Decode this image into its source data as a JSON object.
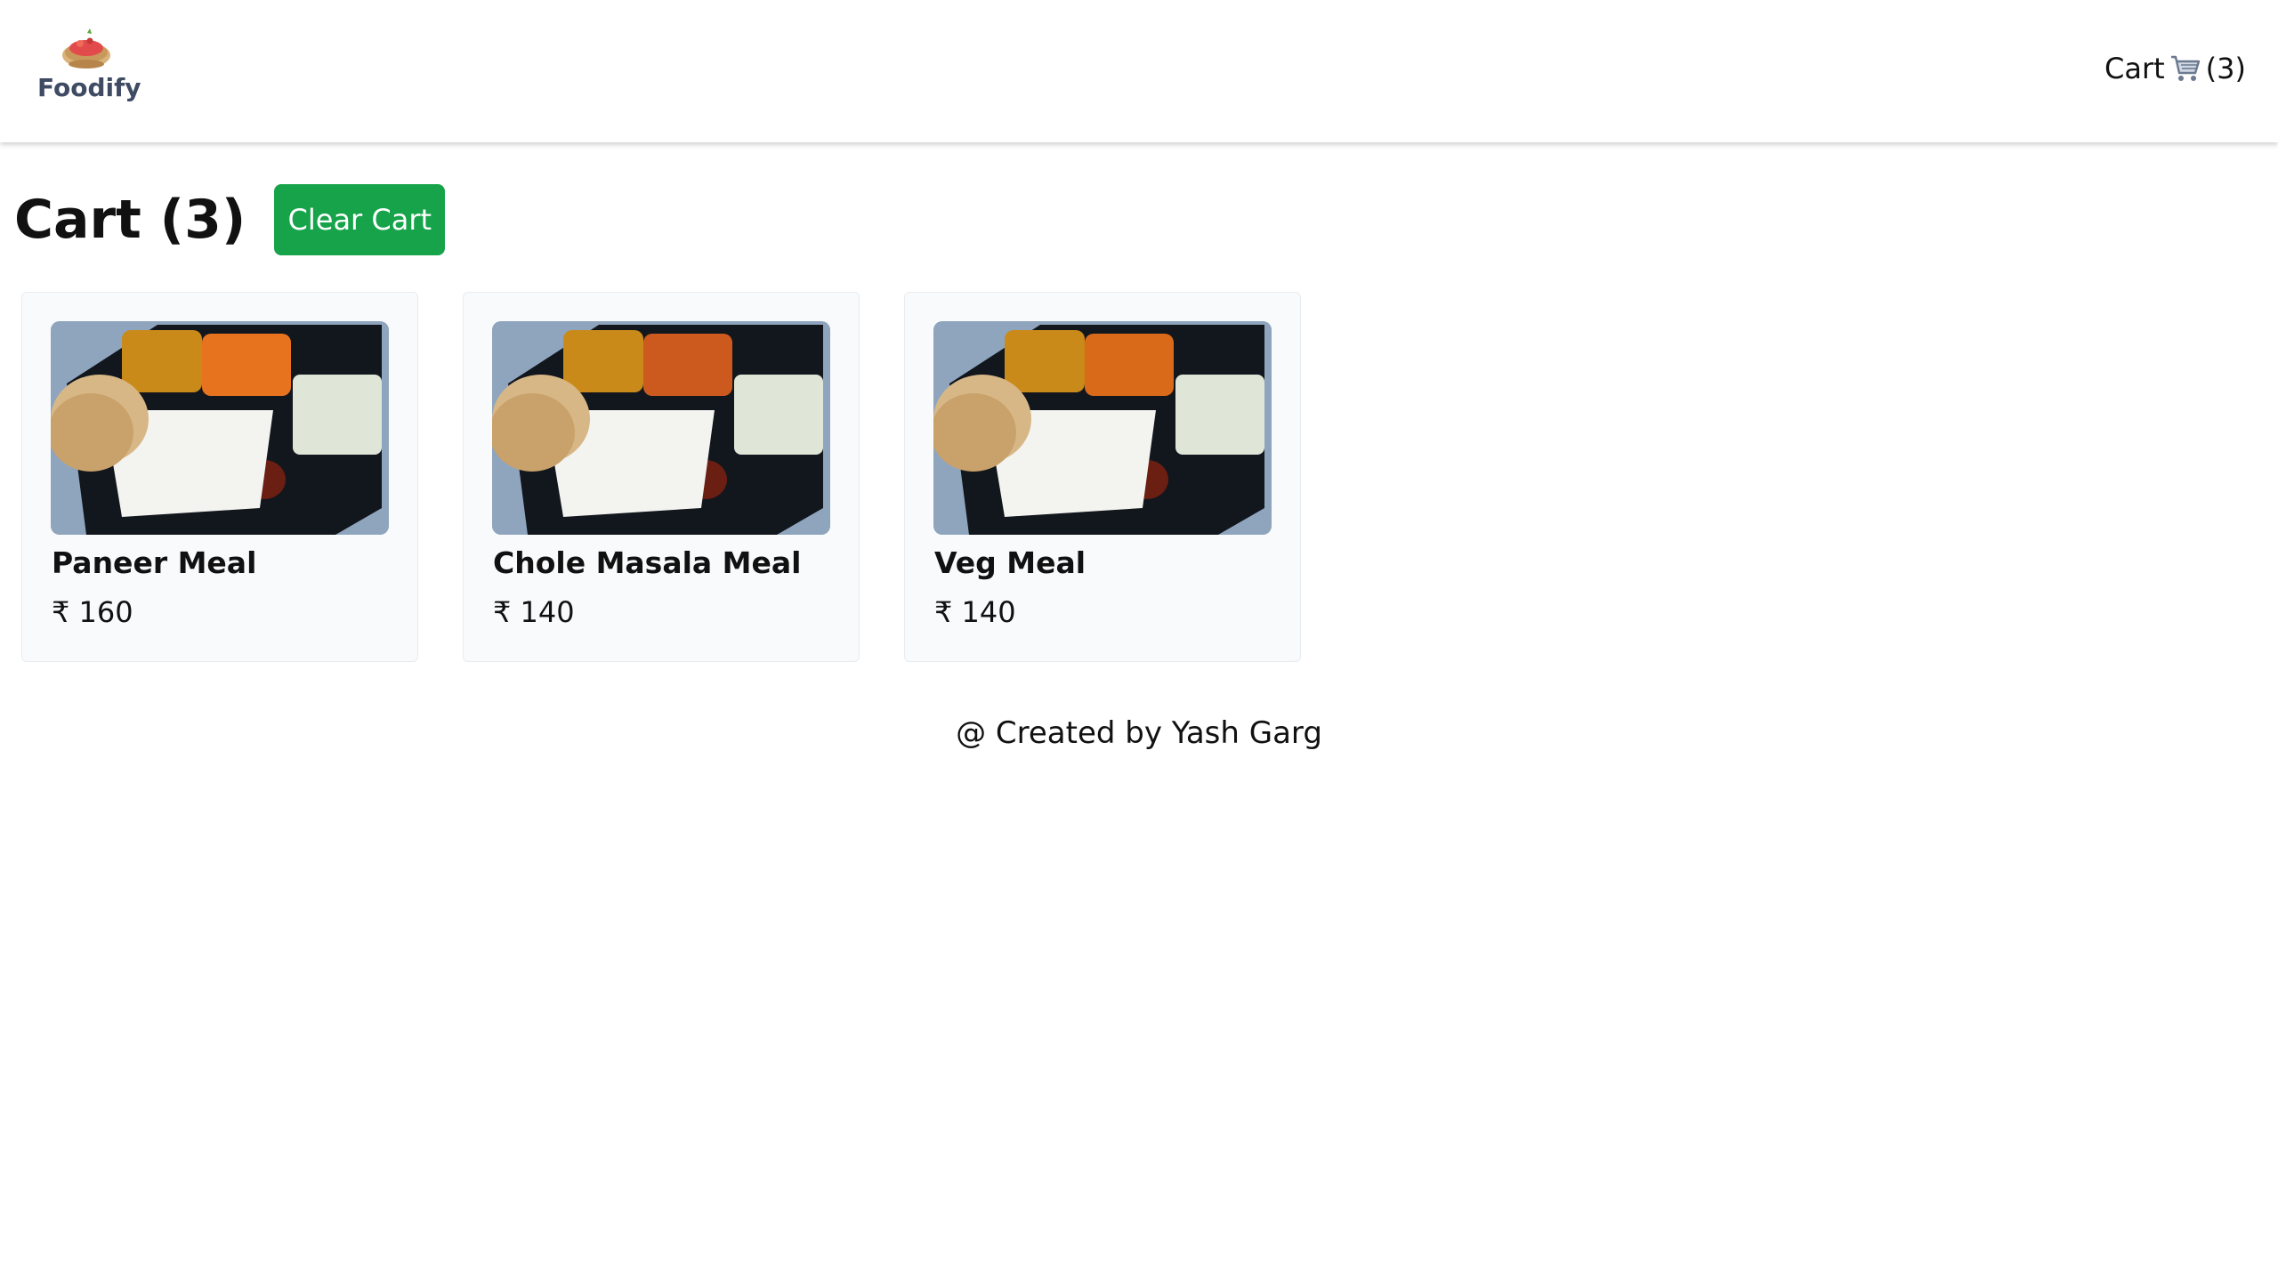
{
  "header": {
    "logo_text": "Foodify",
    "cart_label": "Cart",
    "cart_count": "(3)"
  },
  "cart": {
    "title": "Cart (3)",
    "clear_label": "Clear Cart",
    "items": [
      {
        "name": "Paneer Meal",
        "price": "₹ 160",
        "curry_color": "#e8731f"
      },
      {
        "name": "Chole Masala Meal",
        "price": "₹ 140",
        "curry_color": "#cc5a1e"
      },
      {
        "name": "Veg Meal",
        "price": "₹ 140",
        "curry_color": "#d96a19"
      }
    ]
  },
  "footer": {
    "text": "@ Created by Yash Garg"
  },
  "colors": {
    "accent": "#16a34a",
    "logo_text": "#3f4a63"
  }
}
